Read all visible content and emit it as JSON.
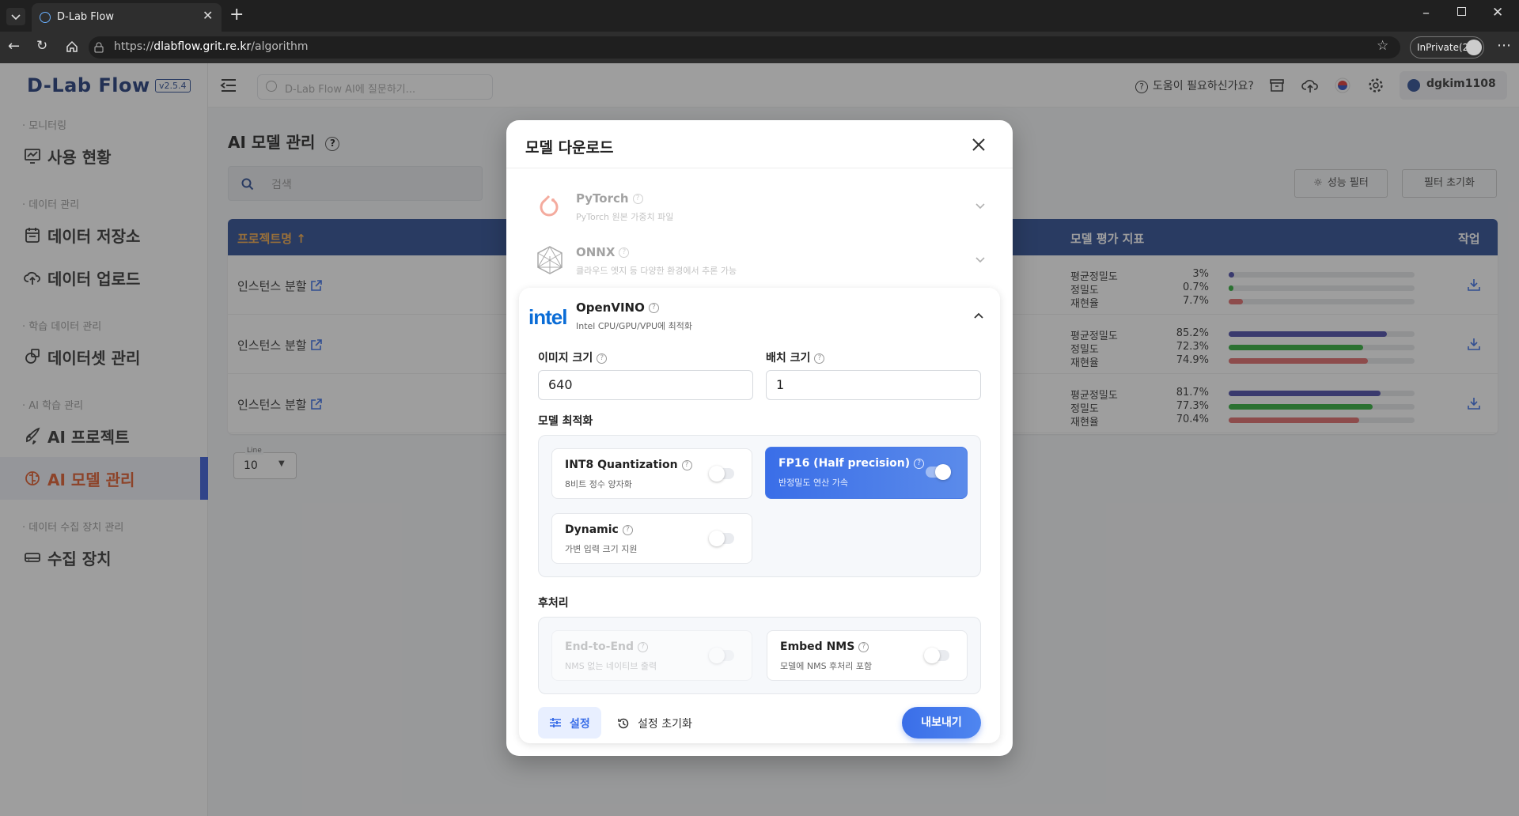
{
  "browser": {
    "tab_title": "D-Lab Flow",
    "url_prefix": "https://",
    "url_domain": "dlabflow.grit.re.kr",
    "url_path": "/algorithm",
    "inprivate_label": "InPrivate(2)"
  },
  "app": {
    "logo": "D-Lab Flow",
    "version": "v2.5.4",
    "ai_placeholder": "D-Lab Flow AI에 질문하기...",
    "help_text": "도움이 필요하신가요?",
    "username": "dgkim1108"
  },
  "sidebar": {
    "sections": [
      {
        "label": "· 모니터링",
        "items": [
          {
            "label": "사용 현황",
            "icon": "monitor-chart-icon"
          }
        ]
      },
      {
        "label": "· 데이터 관리",
        "items": [
          {
            "label": "데이터 저장소",
            "icon": "calendar-storage-icon"
          },
          {
            "label": "데이터 업로드",
            "icon": "cloud-upload-icon"
          }
        ]
      },
      {
        "label": "· 학습 데이터 관리",
        "items": [
          {
            "label": "데이터셋 관리",
            "icon": "dataset-icon"
          }
        ]
      },
      {
        "label": "· AI 학습 관리",
        "items": [
          {
            "label": "AI 프로젝트",
            "icon": "rocket-icon"
          },
          {
            "label": "AI 모델 관리",
            "icon": "brain-icon"
          }
        ]
      },
      {
        "label": "· 데이터 수집 장치 관리",
        "items": [
          {
            "label": "수집 장치",
            "icon": "device-icon"
          }
        ]
      }
    ]
  },
  "page": {
    "title": "AI 모델 관리",
    "search_placeholder": "검색",
    "perf_filter": "성능 필터",
    "filter_reset": "필터 초기화",
    "columns": {
      "project": "프로젝트명",
      "metrics": "모델 평가 지표",
      "action": "작업"
    },
    "rows": [
      {
        "project": "인스턴스 분할",
        "metrics": [
          {
            "name": "평균정밀도",
            "value": "3%",
            "fraction": 0.03
          },
          {
            "name": "정밀도",
            "value": "0.7%",
            "fraction": 0.007
          },
          {
            "name": "재현율",
            "value": "7.7%",
            "fraction": 0.077
          }
        ]
      },
      {
        "project": "인스턴스 분할",
        "metrics": [
          {
            "name": "평균정밀도",
            "value": "85.2%",
            "fraction": 0.852
          },
          {
            "name": "정밀도",
            "value": "72.3%",
            "fraction": 0.723
          },
          {
            "name": "재현율",
            "value": "74.9%",
            "fraction": 0.749
          }
        ]
      },
      {
        "project": "인스턴스 분할",
        "metrics": [
          {
            "name": "평균정밀도",
            "value": "81.7%",
            "fraction": 0.817
          },
          {
            "name": "정밀도",
            "value": "77.3%",
            "fraction": 0.773
          },
          {
            "name": "재현율",
            "value": "70.4%",
            "fraction": 0.704
          }
        ]
      }
    ],
    "metric_colors": [
      "#4a4aa8",
      "#2fae3a",
      "#e06a6a"
    ],
    "line_label": "Line",
    "line_value": "10"
  },
  "modal": {
    "title": "모델 다운로드",
    "formats": [
      {
        "name": "PyTorch",
        "desc": "PyTorch 원본 가중치 파일"
      },
      {
        "name": "ONNX",
        "desc": "클라우드 엣지 등 다양한 환경에서 추론 가능"
      },
      {
        "name": "OpenVINO",
        "desc": "Intel CPU/GPU/VPU에 최적화",
        "logo": "intel"
      }
    ],
    "image_size_label": "이미지 크기",
    "image_size_value": "640",
    "batch_size_label": "배치 크기",
    "batch_size_value": "1",
    "optimization_label": "모델 최적화",
    "optimizations": [
      {
        "name": "INT8 Quantization",
        "desc": "8비트 정수 양자화",
        "enabled": false
      },
      {
        "name": "FP16 (Half precision)",
        "desc": "반정밀도 연산 가속",
        "enabled": true
      },
      {
        "name": "Dynamic",
        "desc": "가변 입력 크기 지원",
        "enabled": false
      }
    ],
    "postprocess_label": "후처리",
    "postprocess": [
      {
        "name": "End-to-End",
        "desc": "NMS 없는 네이티브 출력",
        "enabled": false,
        "disabled": true
      },
      {
        "name": "Embed NMS",
        "desc": "모델에 NMS 후처리 포함",
        "enabled": false
      }
    ],
    "settings_button": "설정",
    "reset_settings": "설정 초기화",
    "export_button": "내보내기"
  },
  "colors": {
    "accent": "#3a6ee8",
    "header": "#2b4b93",
    "active_nav": "#e05a2b"
  }
}
